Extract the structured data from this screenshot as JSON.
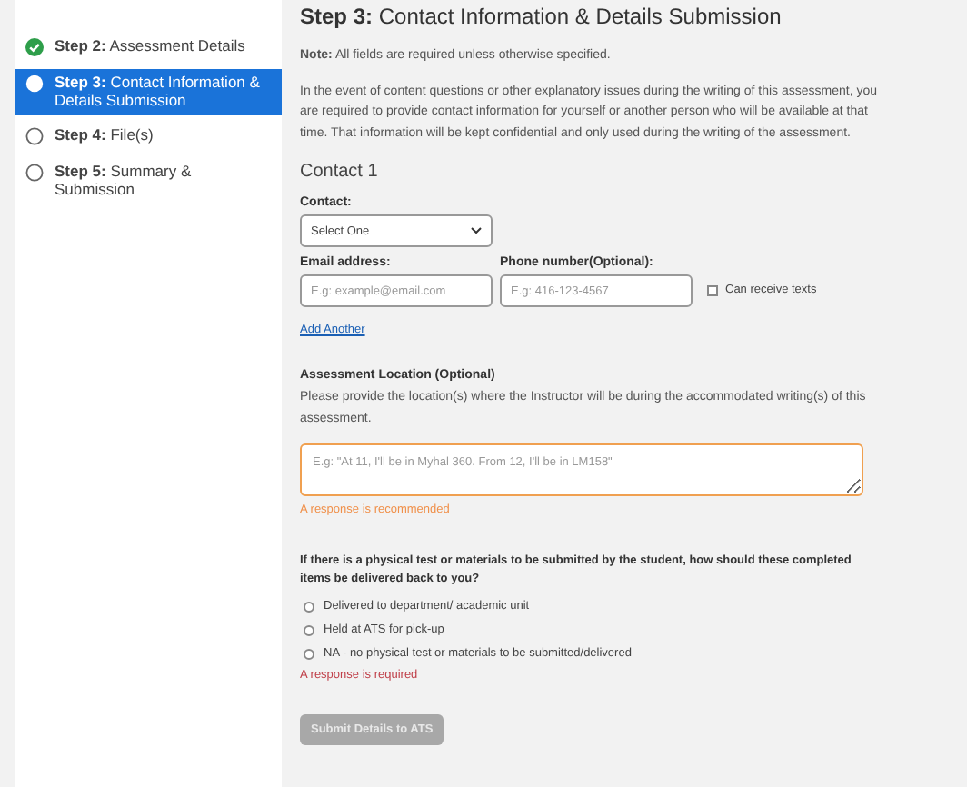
{
  "sidebar": {
    "steps": [
      {
        "step": "Step 2:",
        "label": "Assessment Details",
        "kind": "complete",
        "selected": false
      },
      {
        "step": "Step 3:",
        "label": "Contact Information & Details Submission",
        "kind": "current",
        "selected": true
      },
      {
        "step": "Step 4:",
        "label": "File(s)",
        "kind": "pending",
        "selected": false
      },
      {
        "step": "Step 5:",
        "label": "Summary & Submission",
        "kind": "pending",
        "selected": false
      }
    ]
  },
  "main": {
    "title_step": "Step 3:",
    "title": "Contact Information & Details Submission",
    "note": "**Note:** All fields are required unless otherwise specified.",
    "intro": "In the event of content questions or other explanatory issues during the writing of this assessment, you are required to provide contact information for yourself or another person who will be available at that time. That information will be kept confidential and only used during the writing of the assessment.",
    "contact_heading": "Contact 1",
    "contact_label": "Contact:",
    "contact_select": "Select One",
    "email_label": "Email address:",
    "email_placeholder": "E.g: example@email.com",
    "phone_label": "Phone number(Optional):",
    "phone_placeholder": "E.g: 416-123-4567",
    "texts_checkbox": {
      "label": "Can receive texts",
      "checked": false
    },
    "add_another": "Add Another",
    "location_label": "Assessment Location (Optional)",
    "location_help": "Please provide the location(s) where the Instructor will be during the accommodated writing(s) of this assessment.",
    "location_placeholder": "E.g: \"At 11, I'll be in Myhal 360. From 12, I'll be in LM158\"",
    "location_warning": "A response is recommended",
    "delivery_question": "If there is a physical test or materials to be submitted by the student, how should these completed items be delivered back to you?",
    "delivery_options": [
      {
        "label": "Delivered to department/ academic unit",
        "selected": false
      },
      {
        "label": "Held at ATS for pick-up",
        "selected": false
      },
      {
        "label": "NA - no physical test or materials to be submitted/delivered",
        "selected": false
      }
    ],
    "delivery_error": "A response is required",
    "submit_button": {
      "label": "Submit Details to ATS",
      "disabled": true
    }
  }
}
